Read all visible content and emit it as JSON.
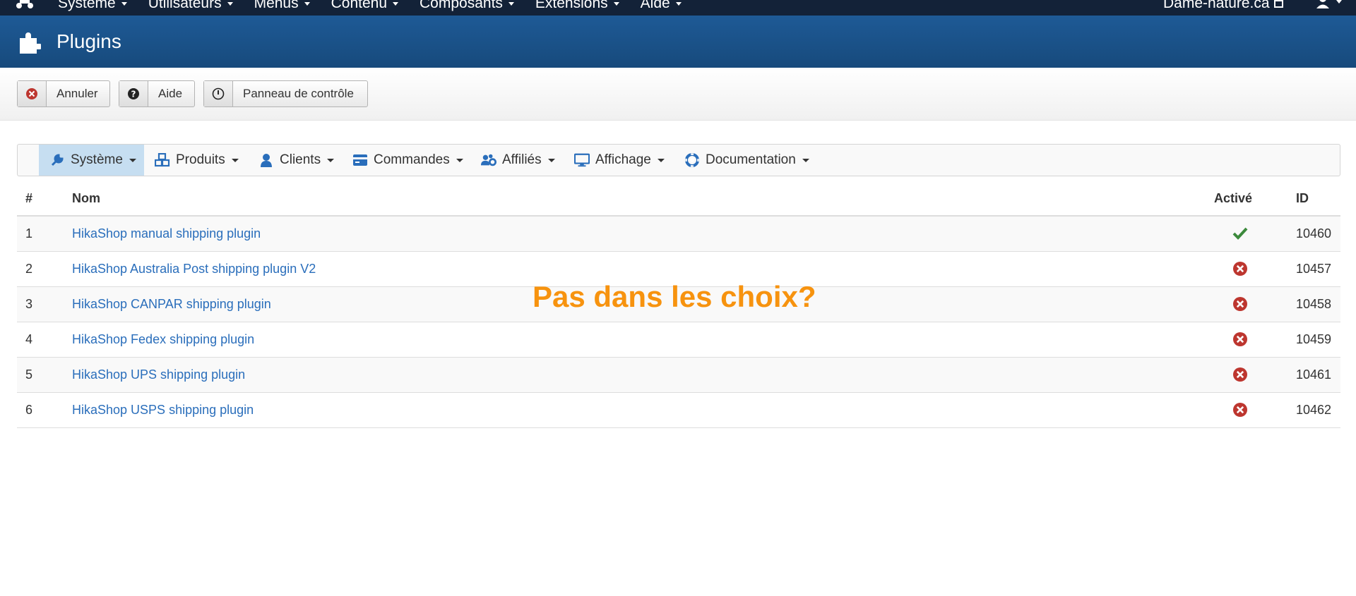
{
  "topbar": {
    "menus": [
      "Système",
      "Utilisateurs",
      "Menus",
      "Contenu",
      "Composants",
      "Extensions",
      "Aide"
    ],
    "site_name": "Dame-nature.ca"
  },
  "header": {
    "title": "Plugins"
  },
  "toolbar": {
    "cancel_label": "Annuler",
    "help_label": "Aide",
    "panel_label": "Panneau de contrôle"
  },
  "nav": {
    "items": [
      {
        "label": "Système",
        "icon": "wrench-icon",
        "active": true
      },
      {
        "label": "Produits",
        "icon": "cubes-icon"
      },
      {
        "label": "Clients",
        "icon": "user-icon"
      },
      {
        "label": "Commandes",
        "icon": "credit-card-icon"
      },
      {
        "label": "Affiliés",
        "icon": "users-gear-icon"
      },
      {
        "label": "Affichage",
        "icon": "monitor-icon"
      },
      {
        "label": "Documentation",
        "icon": "life-ring-icon"
      }
    ]
  },
  "table": {
    "headers": {
      "num": "#",
      "name": "Nom",
      "active": "Activé",
      "id": "ID"
    },
    "rows": [
      {
        "num": "1",
        "name": "HikaShop manual shipping plugin",
        "active": true,
        "id": "10460"
      },
      {
        "num": "2",
        "name": "HikaShop Australia Post shipping plugin V2",
        "active": false,
        "id": "10457"
      },
      {
        "num": "3",
        "name": "HikaShop CANPAR shipping plugin",
        "active": false,
        "id": "10458"
      },
      {
        "num": "4",
        "name": "HikaShop Fedex shipping plugin",
        "active": false,
        "id": "10459"
      },
      {
        "num": "5",
        "name": "HikaShop UPS shipping plugin",
        "active": false,
        "id": "10461"
      },
      {
        "num": "6",
        "name": "HikaShop USPS shipping plugin",
        "active": false,
        "id": "10462"
      }
    ]
  },
  "annotation": {
    "text": "Pas dans les choix?",
    "color": "#f7930f"
  },
  "colors": {
    "link": "#2a6ebb",
    "enabled": "#3c8a3c",
    "disabled": "#bd362f",
    "header_bg": "#1e5a96",
    "topbar_bg": "#132238"
  }
}
